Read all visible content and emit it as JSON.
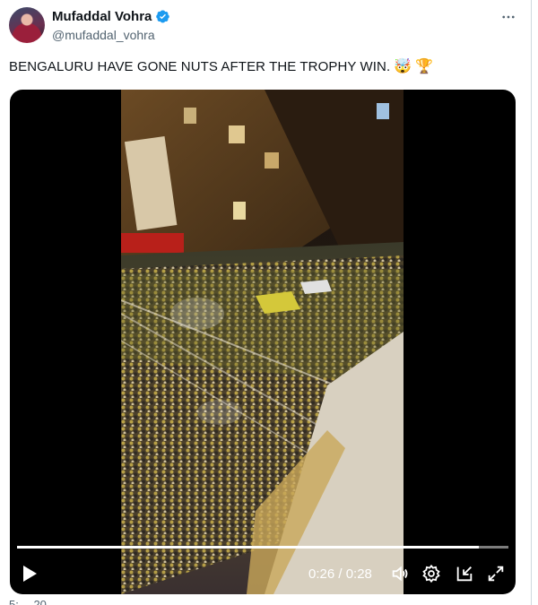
{
  "author": {
    "name": "Mufaddal Vohra",
    "handle": "@mufaddal_vohra",
    "verified": true,
    "avatar_icon": "profile-avatar"
  },
  "tweet": {
    "text": "BENGALURU HAVE GONE NUTS AFTER THE TROPHY WIN.",
    "emojis": [
      "🤯",
      "🏆"
    ]
  },
  "video": {
    "current_time": "0:26",
    "duration": "0:28",
    "time_display": "0:26 / 0:28",
    "progress": 0.94,
    "icons": [
      "play-icon",
      "volume-icon",
      "settings-icon",
      "pip-icon",
      "fullscreen-icon"
    ]
  },
  "footer": {
    "partial_text": "5:… 20…"
  },
  "colors": {
    "accent": "#1d9bf0",
    "text": "#0f1419",
    "muted": "#536471"
  }
}
